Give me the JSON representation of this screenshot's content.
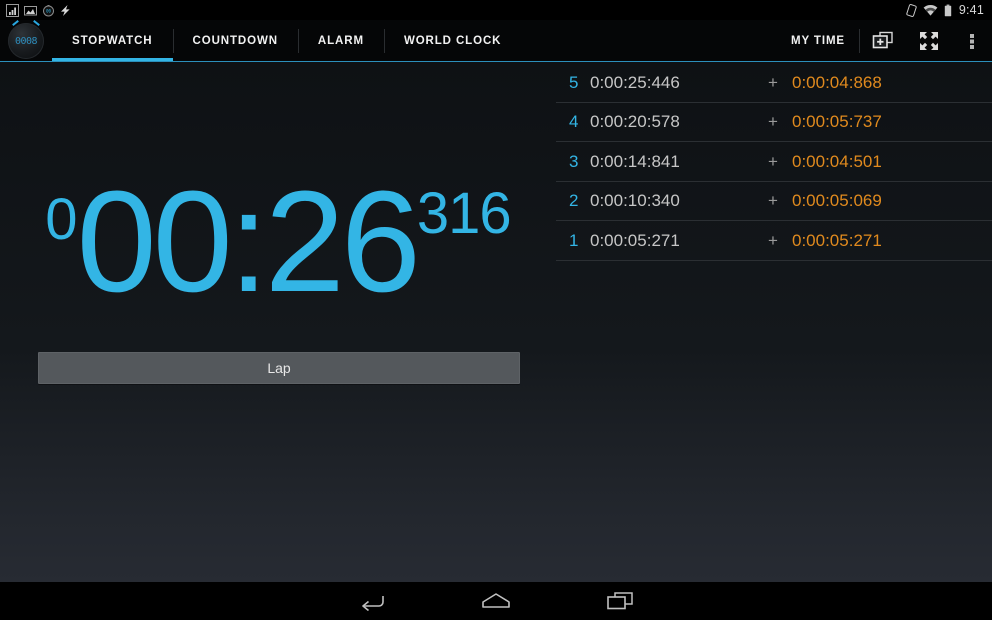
{
  "statusbar": {
    "icons": [
      "signal-bars-icon",
      "screenshot-icon",
      "stopwatch-notification-icon",
      "flash-icon"
    ],
    "right_icons": [
      "rotation-lock-icon",
      "wifi-icon",
      "battery-icon"
    ],
    "clock": "9:41"
  },
  "actionbar": {
    "app_icon_label": "0008",
    "tabs": [
      {
        "label": "STOPWATCH",
        "active": true
      },
      {
        "label": "COUNTDOWN",
        "active": false
      },
      {
        "label": "ALARM",
        "active": false
      },
      {
        "label": "WORLD CLOCK",
        "active": false
      }
    ],
    "my_time_label": "MY TIME",
    "new_timer_icon": "add-stopwatch-icon",
    "fullscreen_icon": "fullscreen-icon",
    "overflow_icon": "overflow-menu-icon"
  },
  "stopwatch": {
    "hours": "0",
    "main": "00:26",
    "millis": "316",
    "lap_button_label": "Lap"
  },
  "laps": {
    "plus_symbol": "+",
    "rows": [
      {
        "index": "5",
        "total": "0:00:25:446",
        "split": "0:00:04:868"
      },
      {
        "index": "4",
        "total": "0:00:20:578",
        "split": "0:00:05:737"
      },
      {
        "index": "3",
        "total": "0:00:14:841",
        "split": "0:00:04:501"
      },
      {
        "index": "2",
        "total": "0:00:10:340",
        "split": "0:00:05:069"
      },
      {
        "index": "1",
        "total": "0:00:05:271",
        "split": "0:00:05:271"
      }
    ]
  },
  "navbar": {
    "back_icon": "back-icon",
    "home_icon": "home-icon",
    "recents_icon": "recents-icon"
  },
  "colors": {
    "accent": "#33b5e5",
    "split": "#e08a1e",
    "total": "#c6c6c6",
    "button": "#54585c"
  }
}
